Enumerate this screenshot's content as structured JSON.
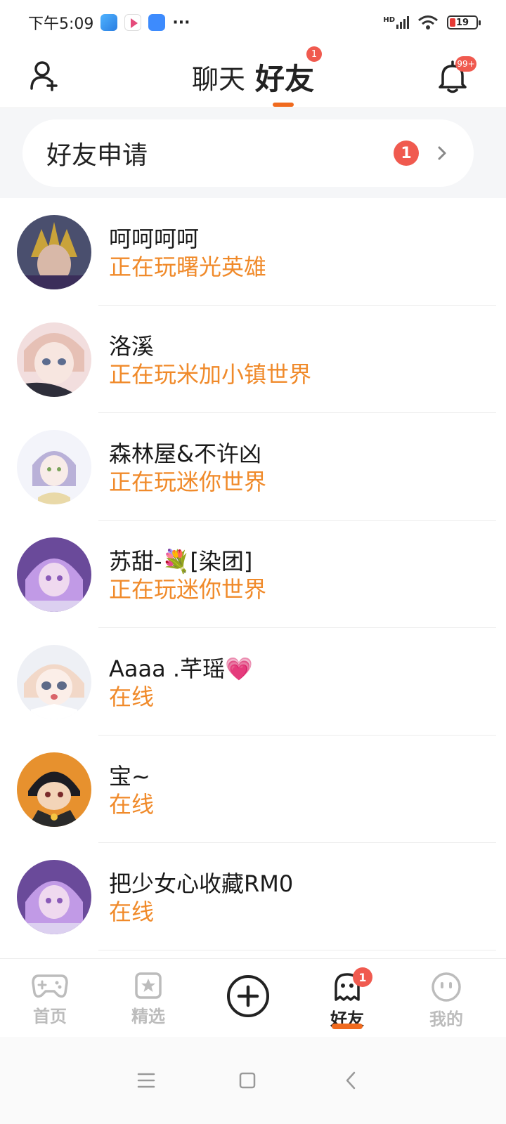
{
  "status_bar": {
    "time": "下午5:09",
    "more": "···",
    "network": "HD",
    "battery": "19"
  },
  "header": {
    "tab_chat": "聊天",
    "tab_friends": "好友",
    "tab_friends_badge": "1",
    "notifications_badge": "99+"
  },
  "friend_requests": {
    "label": "好友申请",
    "count": "1"
  },
  "friends": [
    {
      "name": "呵呵呵呵",
      "status": "正在玩曙光英雄"
    },
    {
      "name": "洛溪",
      "status": "正在玩米加小镇世界"
    },
    {
      "name": "森林屋&不许凶",
      "status": "正在玩迷你世界"
    },
    {
      "name": "苏甜-💐[染团]",
      "status": "正在玩迷你世界"
    },
    {
      "name": "Aaaa .芊瑶💗",
      "status": "在线"
    },
    {
      "name": "宝~",
      "status": "在线"
    },
    {
      "name": "把少女心收藏RM0",
      "status": "在线"
    }
  ],
  "bottom_nav": {
    "home": "首页",
    "featured": "精选",
    "friends": "好友",
    "friends_badge": "1",
    "mine": "我的"
  },
  "colors": {
    "accent": "#f06a1e",
    "status_text": "#f08a2a",
    "badge": "#f05a4f"
  }
}
